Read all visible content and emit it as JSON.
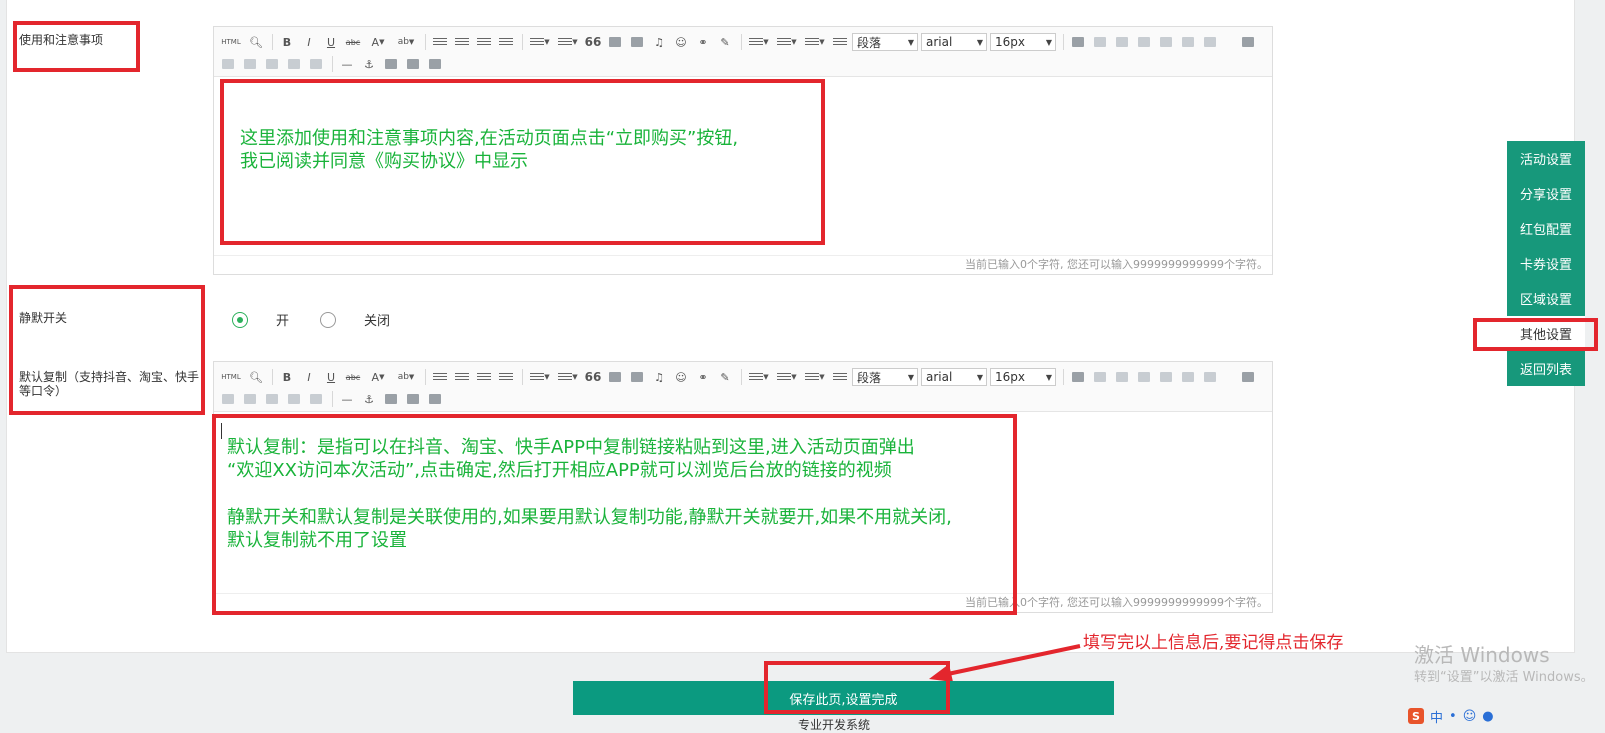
{
  "fields": {
    "usage_label": "使用和注意事项",
    "mute_label": "静默开关",
    "default_copy_label": "默认复制（支持抖音、淘宝、快手等口令）"
  },
  "toolbar": {
    "html_btn": "HTML",
    "bold": "B",
    "italic": "I",
    "underline": "U",
    "strike": "abc",
    "font_color": "A",
    "quote": "66",
    "paragraph": "段落",
    "font": "arial",
    "size": "16px"
  },
  "editor1": {
    "content_line1": "这里添加使用和注意事项内容,在活动页面点击“立即购买”按钮,",
    "content_line2": "我已阅读并同意《购买协议》中显示",
    "counter": "当前已输入0个字符, 您还可以输入9999999999999个字符。"
  },
  "mute": {
    "on_label": "开",
    "off_label": "关闭",
    "selected": "开"
  },
  "editor2": {
    "line1": "默认复制：是指可以在抖音、淘宝、快手APP中复制链接粘贴到这里,进入活动页面弹出",
    "line2": "“欢迎XX访问本次活动”,点击确定,然后打开相应APP就可以浏览后台放的链接的视频",
    "line3": "静默开关和默认复制是关联使用的,如果要用默认复制功能,静默开关就要开,如果不用就关闭,",
    "line4": "默认复制就不用了设置",
    "counter": "当前已输入0个字符, 您还可以输入9999999999999个字符。"
  },
  "side_nav": {
    "items": [
      "活动设置",
      "分享设置",
      "红包配置",
      "卡券设置",
      "区域设置",
      "其他设置",
      "返回列表"
    ],
    "active": "其他设置"
  },
  "save_button": "保存此页,设置完成",
  "footer": "专业开发系统",
  "annotation": "填写完以上信息后,要记得点击保存",
  "watermark": {
    "title": "激活 Windows",
    "subtitle": "转到“设置”以激活 Windows。"
  },
  "tray": {
    "ime_logo": "S",
    "ime_lang": "中"
  },
  "colors": {
    "accent": "#17987b",
    "highlight_red": "#e3262d",
    "note_green": "#19b33a"
  }
}
